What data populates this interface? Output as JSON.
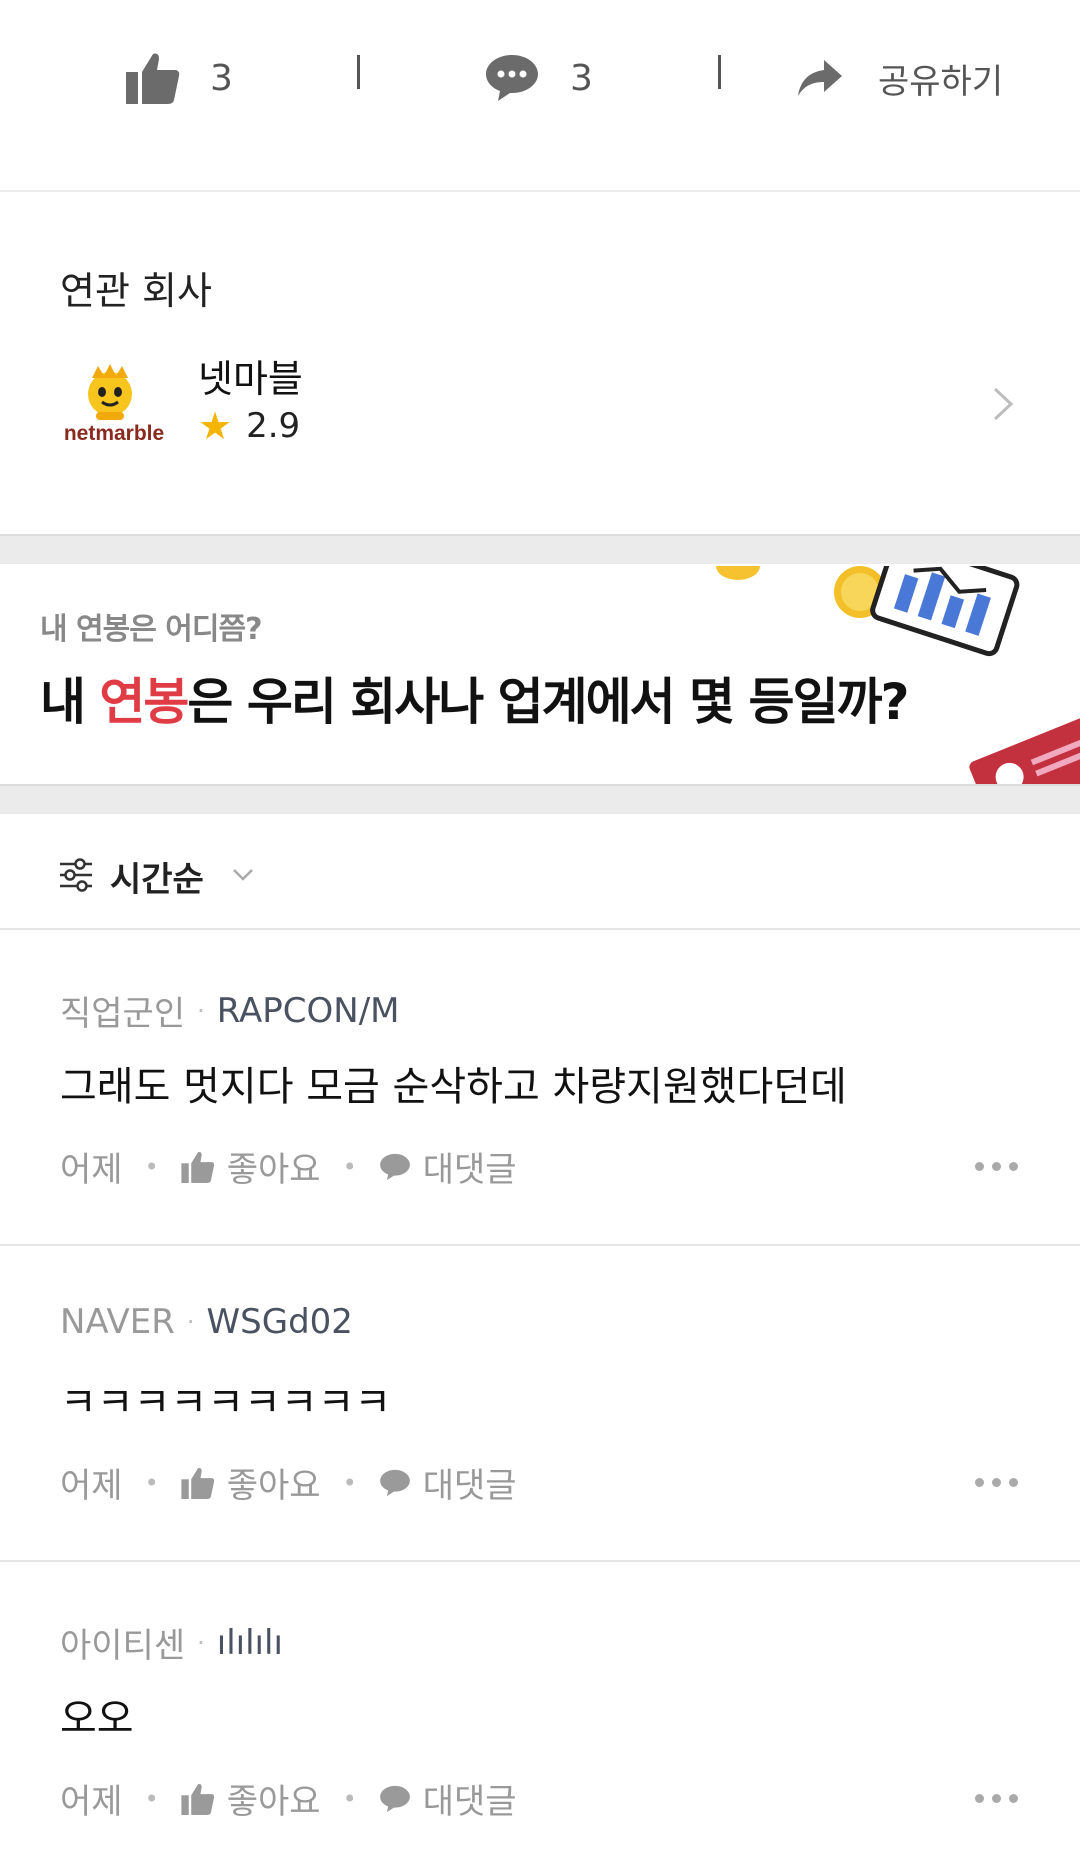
{
  "action_bar": {
    "like_count": "3",
    "comment_count": "3",
    "share_label": "공유하기"
  },
  "related": {
    "title": "연관 회사",
    "company": {
      "logo_text": "netmarble",
      "name": "넷마블",
      "rating": "2.9"
    }
  },
  "banner": {
    "subtitle": "내 연봉은 어디쯤?",
    "headline_pre": "내 ",
    "headline_highlight": "연봉",
    "headline_post": "은 우리 회사나 업계에서 몇 등일까?",
    "accent_color": "#e03c46"
  },
  "sort": {
    "label": "시간순"
  },
  "comments": [
    {
      "company": "직업군인",
      "user": "RAPCON/M",
      "text": "그래도 멋지다 모금 순삭하고 차량지원했다던데",
      "time": "어제",
      "like_label": "좋아요",
      "reply_label": "대댓글"
    },
    {
      "company": "NAVER",
      "user": "WSGd02",
      "text": "ㅋㅋㅋㅋㅋㅋㅋㅋㅋ",
      "time": "어제",
      "like_label": "좋아요",
      "reply_label": "대댓글"
    },
    {
      "company": "아이티센",
      "user": "ılılılı",
      "text": "오오",
      "time": "어제",
      "like_label": "좋아요",
      "reply_label": "대댓글"
    }
  ]
}
